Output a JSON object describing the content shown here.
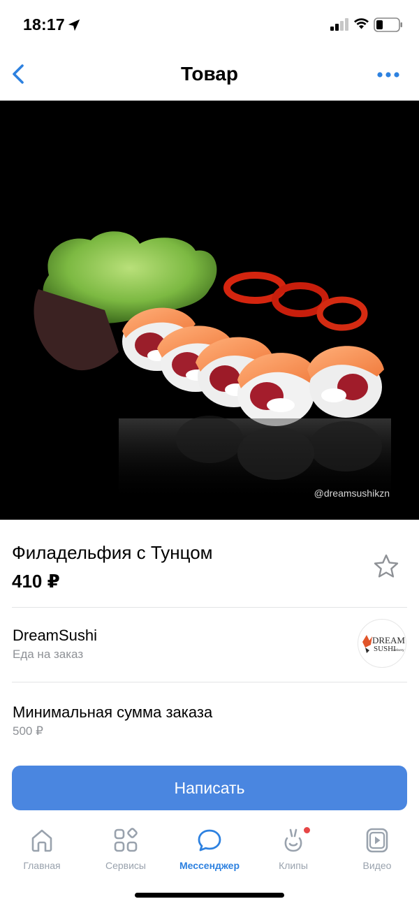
{
  "status_bar": {
    "time": "18:17"
  },
  "nav": {
    "title": "Товар",
    "back_icon": "chevron-left-icon",
    "more_icon": "more-horizontal-icon"
  },
  "hero": {
    "watermark": "@dreamsushikzn"
  },
  "product": {
    "title": "Филадельфия с Тунцом",
    "price": "410 ₽",
    "favorite_icon": "star-outline-icon"
  },
  "shop": {
    "name": "DreamSushi",
    "subtitle": "Еда на заказ",
    "logo_text": "DREAM SUSHI",
    "logo_sub": "delivery"
  },
  "minimum_order": {
    "label": "Минимальная сумма заказа",
    "value": "500 ₽"
  },
  "action": {
    "write_label": "Написать"
  },
  "tabs": [
    {
      "label": "Главная",
      "icon": "home-icon",
      "active": false
    },
    {
      "label": "Сервисы",
      "icon": "services-grid-icon",
      "active": false
    },
    {
      "label": "Мессенджер",
      "icon": "messenger-icon",
      "active": true
    },
    {
      "label": "Клипы",
      "icon": "clips-icon",
      "active": false,
      "badge": true
    },
    {
      "label": "Видео",
      "icon": "video-icon",
      "active": false
    }
  ],
  "colors": {
    "accent": "#4a86e0",
    "tab_active": "#2d81e0",
    "tab_inactive": "#99a2ad",
    "secondary_text": "#8e9196",
    "badge": "#e64646"
  }
}
